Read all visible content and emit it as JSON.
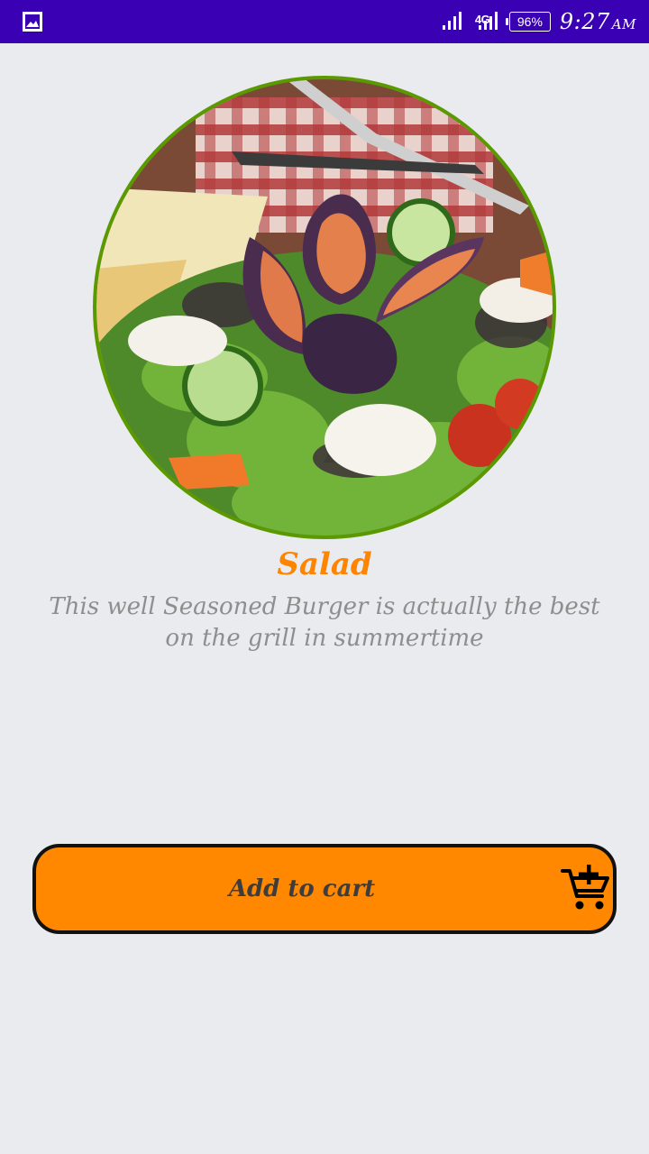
{
  "status_bar": {
    "network_label": "4G",
    "battery": "96%",
    "time": "9:27",
    "ampm": "AM"
  },
  "product": {
    "title": "Salad",
    "description": "This well Seasoned Burger is actually the best on the grill in summertime"
  },
  "cart_button": {
    "label": "Add to cart",
    "icon": "add-shopping-cart-icon"
  },
  "colors": {
    "status_bar": "#3a00b3",
    "accent": "#ff8400",
    "button": "#ff8800",
    "background": "#e9ebee",
    "image_border": "#5a9a00"
  }
}
